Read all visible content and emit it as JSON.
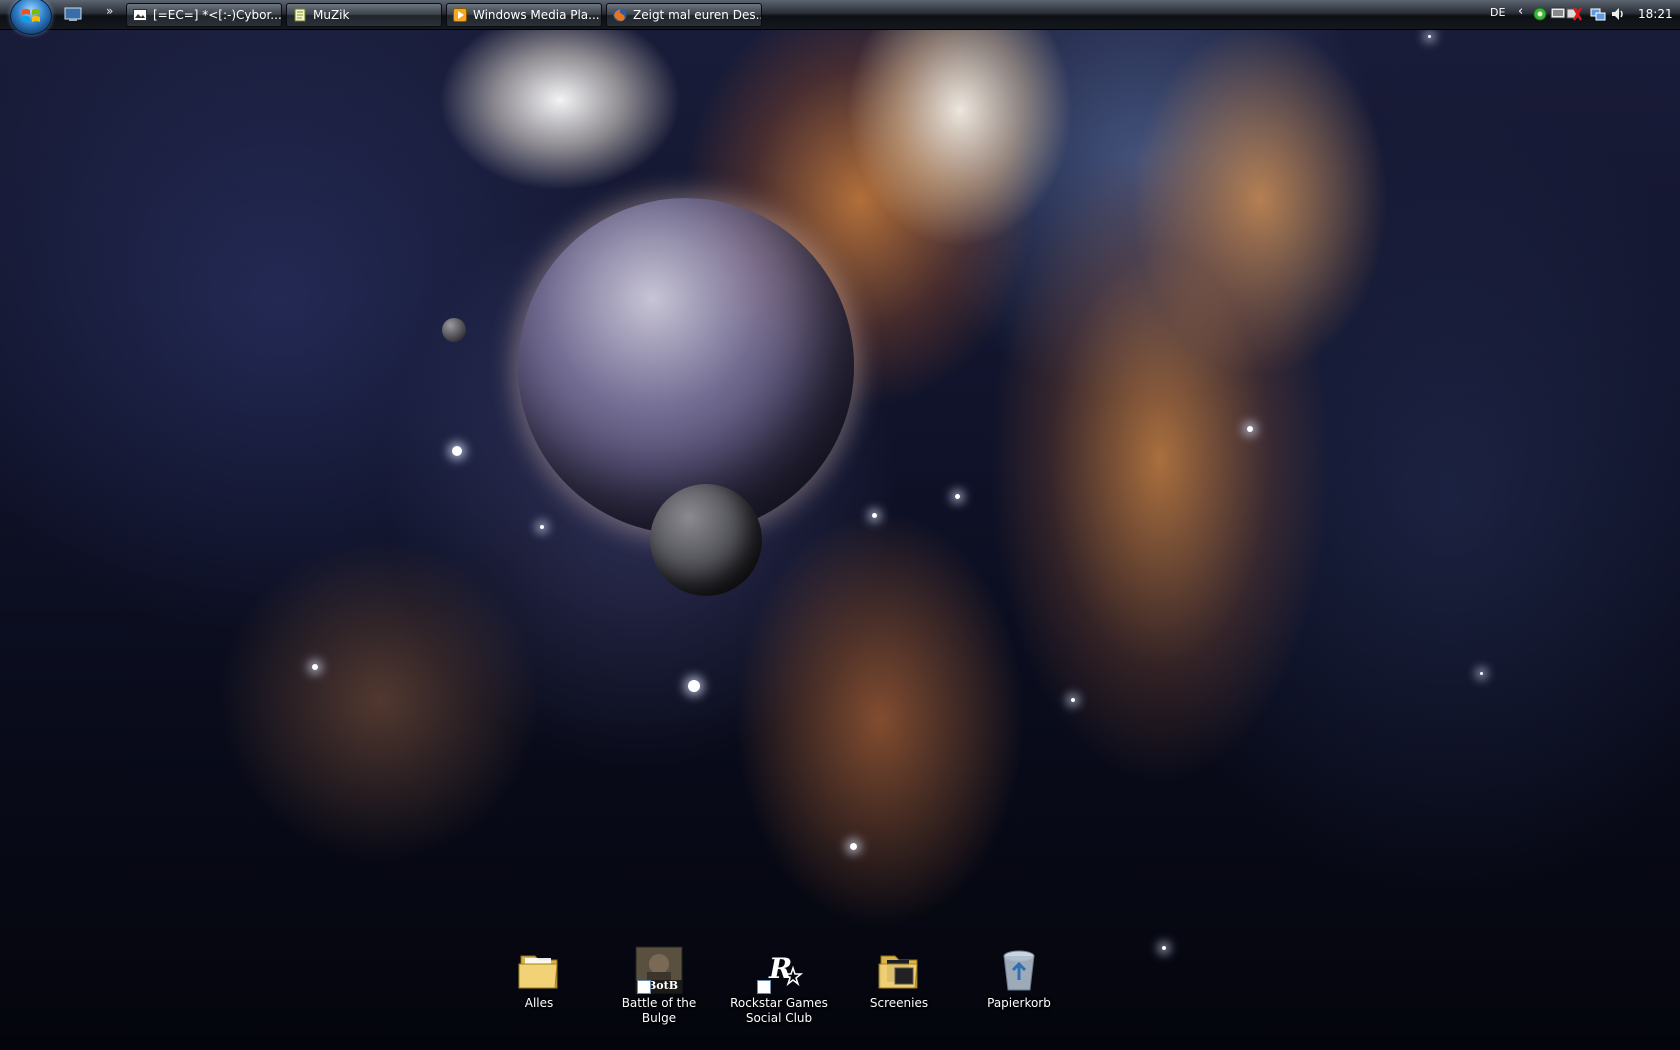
{
  "taskbar": {
    "tasks": [
      {
        "label": "[=EC=] *<[:-)Cybor...",
        "icon": "picture-window-icon"
      },
      {
        "label": "MuZik",
        "icon": "notepad-icon"
      },
      {
        "label": "Windows Media Pla...",
        "icon": "media-player-icon"
      },
      {
        "label": "Zeigt mal euren Des...",
        "icon": "firefox-icon"
      }
    ],
    "quicklaunch_more": "»"
  },
  "tray": {
    "language": "DE",
    "expand": "‹",
    "clock": "18:21"
  },
  "desktop": {
    "icons": [
      {
        "label": "Alles",
        "icon": "folder-icon"
      },
      {
        "label": "Battle of the Bulge",
        "icon": "botb-game-icon",
        "badge": "BotB"
      },
      {
        "label": "Rockstar Games Social Club",
        "icon": "rockstar-icon"
      },
      {
        "label": "Screenies",
        "icon": "folder-icon"
      },
      {
        "label": "Papierkorb",
        "icon": "recycle-bin-icon"
      }
    ]
  },
  "colors": {
    "taskbar_top": "#5b6470",
    "taskbar_bottom": "#14181d",
    "start_orb": "#2f7fc8"
  }
}
